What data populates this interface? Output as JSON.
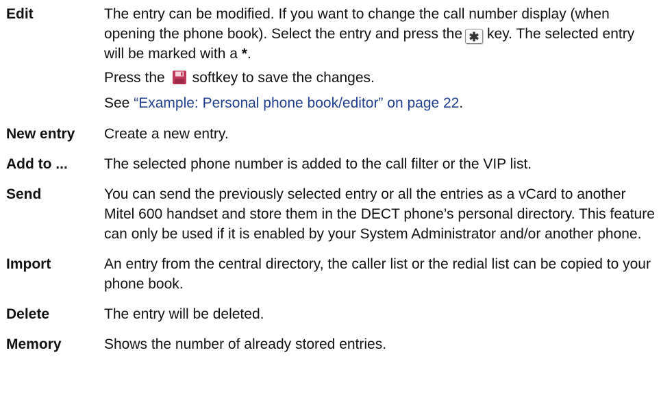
{
  "items": [
    {
      "term": "Edit",
      "line1": "The entry can be modified. If you want to change the call number display (when opening the phone book). Select the entry and press the",
      "line1_after": "key. The selected entry will be marked with a",
      "line1_mark": "*",
      "line1_end": ".",
      "key_symbol": "*",
      "key_icon": "star-key-icon",
      "line2_before": "Press the",
      "line2_icon": "floppy-disk-save-icon",
      "line2_after": "softkey to save the changes.",
      "line3_before": "See",
      "line3_link": "“Example: Personal phone book/editor” on page 22",
      "line3_after": "."
    },
    {
      "term": "New entry",
      "text": "Create a new entry."
    },
    {
      "term": "Add to ...",
      "text": "The selected phone number is added to the call filter or the VIP list."
    },
    {
      "term": "Send",
      "text": "You can send the previously selected entry or all the entries as a vCard to another Mitel 600 handset and store them in the DECT phone’s personal directory. This feature can only be used if it is enabled by your System Administrator and/or another phone."
    },
    {
      "term": "Import",
      "text": "An entry from the central directory, the caller list or the redial list can be copied to your phone book."
    },
    {
      "term": "Delete",
      "text": "The entry will be deleted."
    },
    {
      "term": "Memory",
      "text": "Shows the number of already stored entries."
    }
  ],
  "colors": {
    "text": "#111111",
    "link": "#1f3f8f",
    "save_icon": "#c0395a"
  }
}
